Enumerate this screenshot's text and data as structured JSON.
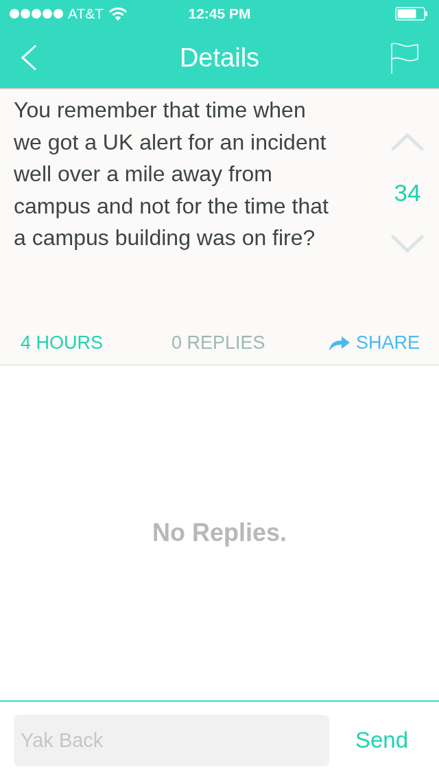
{
  "status_bar": {
    "carrier": "AT&T",
    "time": "12:45 PM"
  },
  "nav_bar": {
    "title": "Details"
  },
  "post": {
    "text": "You remember that time when we got a UK alert for an incident well over a mile away from campus and not for the time that a campus building was on fire?",
    "votes": "34",
    "age": "4 HOURS",
    "replies": "0 REPLIES",
    "share": "SHARE"
  },
  "empty_state": "No Replies.",
  "reply_bar": {
    "placeholder": "Yak Back",
    "send": "Send"
  }
}
